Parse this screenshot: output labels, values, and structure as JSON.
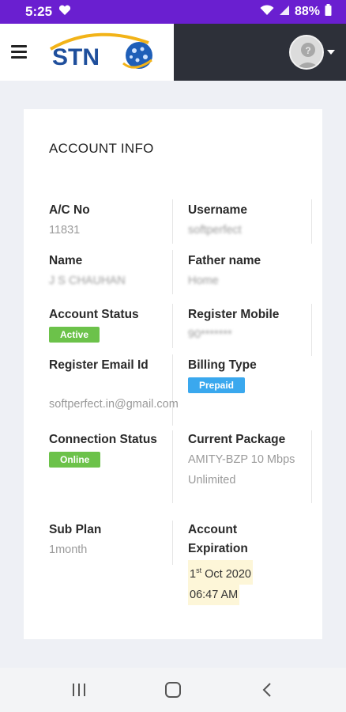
{
  "status_bar": {
    "time": "5:25",
    "battery": "88%"
  },
  "app": {
    "brand": "STN"
  },
  "card": {
    "title": "ACCOUNT INFO",
    "fields": {
      "ac_no": {
        "label": "A/C No",
        "value": "11831"
      },
      "username": {
        "label": "Username",
        "value": "softperfect"
      },
      "name": {
        "label": "Name",
        "value": "J S CHAUHAN"
      },
      "father_name": {
        "label": "Father name",
        "value": "Home"
      },
      "account_status": {
        "label": "Account Status",
        "value": "Active"
      },
      "register_mobile": {
        "label": "Register Mobile",
        "value": "90*******"
      },
      "register_email": {
        "label": "Register Email Id",
        "value": "softperfect.in@gmail.com"
      },
      "billing_type": {
        "label": "Billing Type",
        "value": "Prepaid"
      },
      "connection_status": {
        "label": "Connection Status",
        "value": "Online"
      },
      "current_package": {
        "label": "Current Package",
        "value": "AMITY-BZP 10 Mbps Unlimited"
      },
      "sub_plan": {
        "label": "Sub Plan",
        "value": "1month"
      },
      "account_expiration": {
        "label": "Account Expiration",
        "value_day": "1",
        "value_suffix": "st",
        "value_rest": " Oct 2020",
        "value_time": "06:47 AM"
      }
    }
  },
  "colors": {
    "status_bar": "#6a1fd0",
    "active_badge": "#6cc24a",
    "prepaid_badge": "#3aa8ee"
  }
}
